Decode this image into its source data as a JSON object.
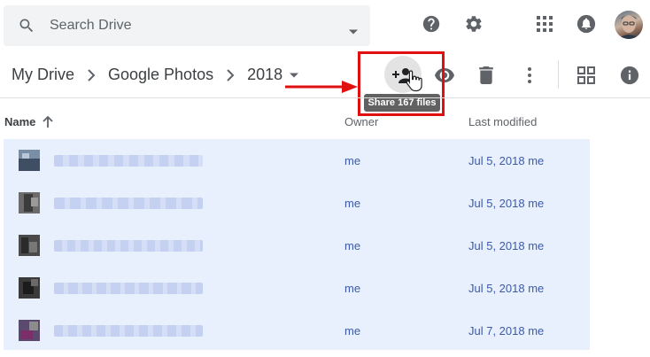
{
  "search": {
    "placeholder": "Search Drive"
  },
  "header_icons": [
    "help-icon",
    "settings-icon",
    "apps-grid-icon",
    "notifications-icon",
    "avatar"
  ],
  "breadcrumb": {
    "items": [
      "My Drive",
      "Google Photos",
      "2018"
    ]
  },
  "toolbar": {
    "share_tooltip": "Share 167 files",
    "buttons": [
      "share-icon",
      "preview-eye-icon",
      "delete-icon",
      "more-vert-icon",
      "grid-view-icon",
      "details-info-icon"
    ]
  },
  "columns": {
    "name": "Name",
    "owner": "Owner",
    "last_modified": "Last modified"
  },
  "rows": [
    {
      "owner": "me",
      "modified": "Jul 5, 2018 me"
    },
    {
      "owner": "me",
      "modified": "Jul 5, 2018 me"
    },
    {
      "owner": "me",
      "modified": "Jul 5, 2018 me"
    },
    {
      "owner": "me",
      "modified": "Jul 5, 2018 me"
    },
    {
      "owner": "me",
      "modified": "Jul 7, 2018 me"
    }
  ],
  "colors": {
    "selection": "#e8f0fe",
    "link_text": "#3c5aa8",
    "annotation": "#e01010"
  }
}
